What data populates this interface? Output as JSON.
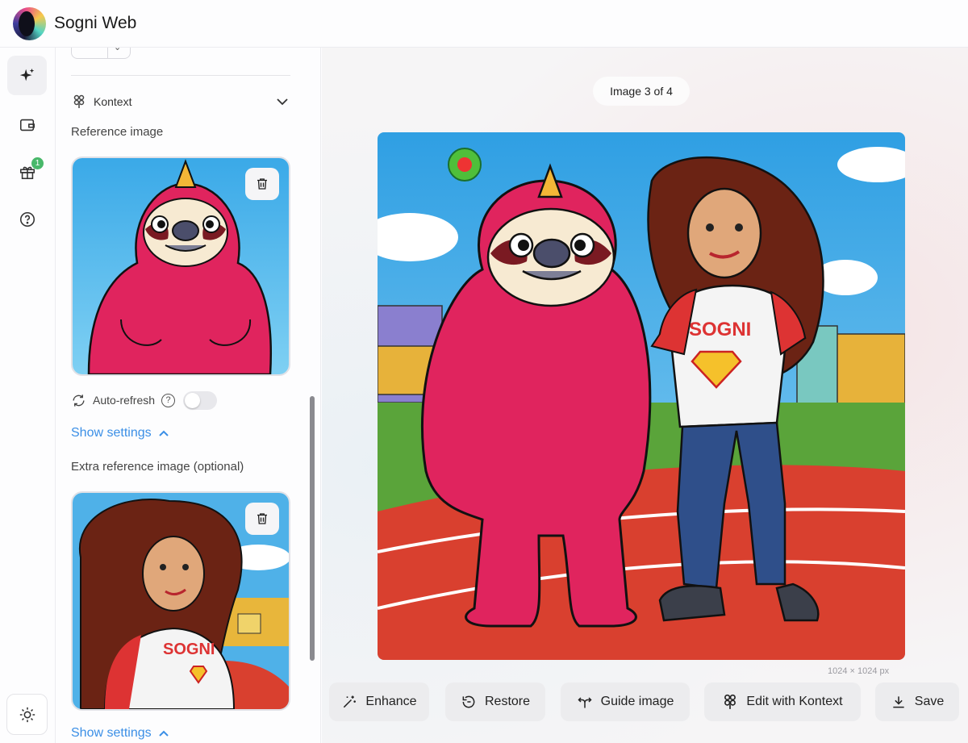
{
  "app": {
    "title": "Sogni Web"
  },
  "rail": {
    "items": [
      {
        "name": "generate",
        "icon": "sparkles-icon",
        "active": true
      },
      {
        "name": "wallet",
        "icon": "wallet-icon"
      },
      {
        "name": "rewards",
        "icon": "gift-icon",
        "badge": "1"
      },
      {
        "name": "help",
        "icon": "help-circle-icon"
      }
    ],
    "theme_icon": "sun-icon"
  },
  "panel": {
    "kontext_label": "Kontext",
    "reference_image_label": "Reference image",
    "auto_refresh_label": "Auto-refresh",
    "help_glyph": "?",
    "auto_refresh_on": false,
    "show_settings_1": "Show settings",
    "extra_reference_label": "Extra reference image (optional)",
    "show_settings_2": "Show settings"
  },
  "main": {
    "image_counter": "Image 3 of 4",
    "image_dimensions": "1024 × 1024 px",
    "actions": [
      {
        "label": "Enhance",
        "icon": "magic-wand-icon"
      },
      {
        "label": "Restore",
        "icon": "restore-icon"
      },
      {
        "label": "Guide image",
        "icon": "guide-arrows-icon"
      },
      {
        "label": "Edit with Kontext",
        "icon": "kontext-icon"
      },
      {
        "label": "Save",
        "icon": "download-icon"
      }
    ]
  },
  "colors": {
    "accent_link": "#3b8fe6",
    "badge_green": "#48b86a",
    "sloth_pink": "#e0245e",
    "sky_blue": "#4ab6ea",
    "track_red": "#d9402f"
  }
}
